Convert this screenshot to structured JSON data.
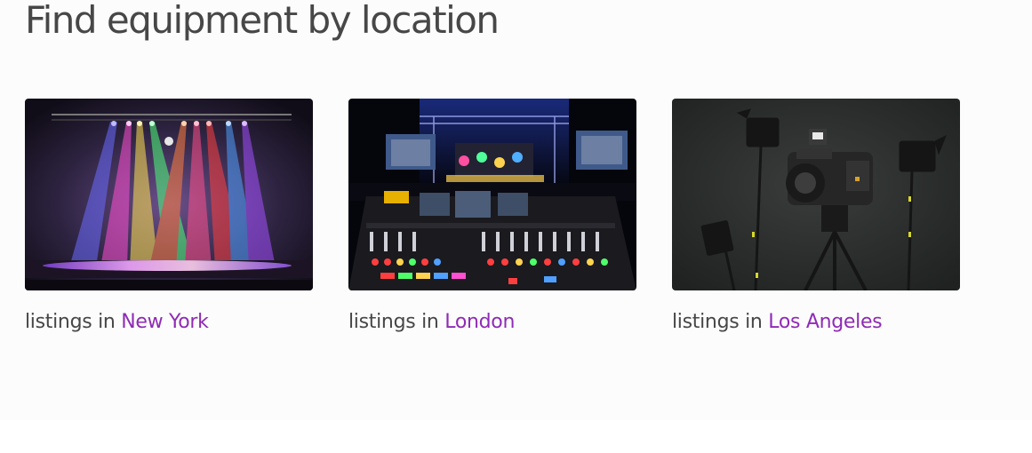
{
  "section": {
    "title": "Find equipment by location"
  },
  "locations": [
    {
      "prefix": "listings in",
      "city": "New York",
      "image": "stage-lights-photo"
    },
    {
      "prefix": "listings in",
      "city": "London",
      "image": "concert-mixing-desk-photo"
    },
    {
      "prefix": "listings in",
      "city": "Los Angeles",
      "image": "camera-and-lights-photo"
    }
  ],
  "colors": {
    "accent": "#8f2bb5",
    "text": "#474747",
    "background": "#fcfcfc"
  }
}
